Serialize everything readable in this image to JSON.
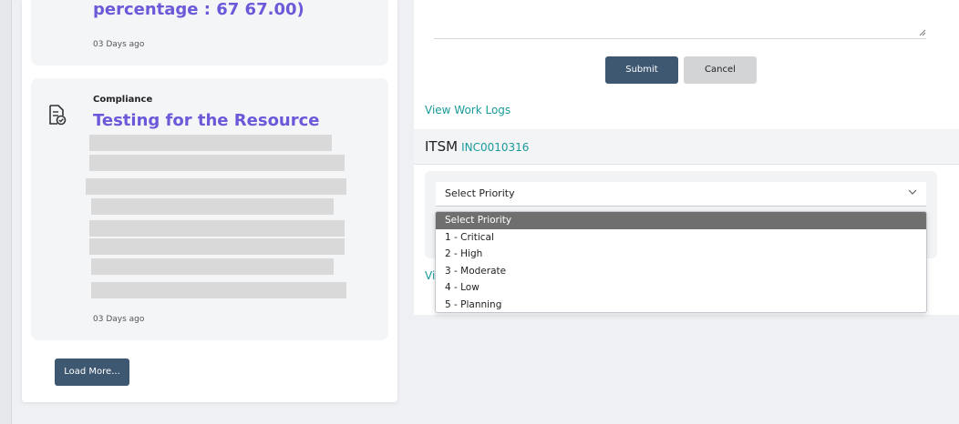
{
  "activity_list": {
    "card1": {
      "title": "percentage : 67 67.00)",
      "time": "03 Days ago"
    },
    "card2": {
      "category": "Compliance",
      "title": "Testing for the Resource",
      "time": "03 Days ago",
      "icon": "document-check-icon"
    },
    "load_more_label": "Load More..."
  },
  "worklog_form": {
    "submit_label": "Submit",
    "cancel_label": "Cancel",
    "view_work_logs": "View Work Logs"
  },
  "itsm": {
    "label": "ITSM",
    "ticket_id": "INC0010316",
    "priority_select": {
      "selected": "Select Priority",
      "options": [
        "Select Priority",
        "1 - Critical",
        "2 - High",
        "3 - Moderate",
        "4 - Low",
        "5 - Planning"
      ]
    },
    "partial_link": "Vi"
  },
  "colors": {
    "accent_purple": "#6a5ad9",
    "link_teal": "#1a9a9a",
    "button_dark": "#3f5872",
    "dropdown_highlight": "#6f6f6f"
  }
}
